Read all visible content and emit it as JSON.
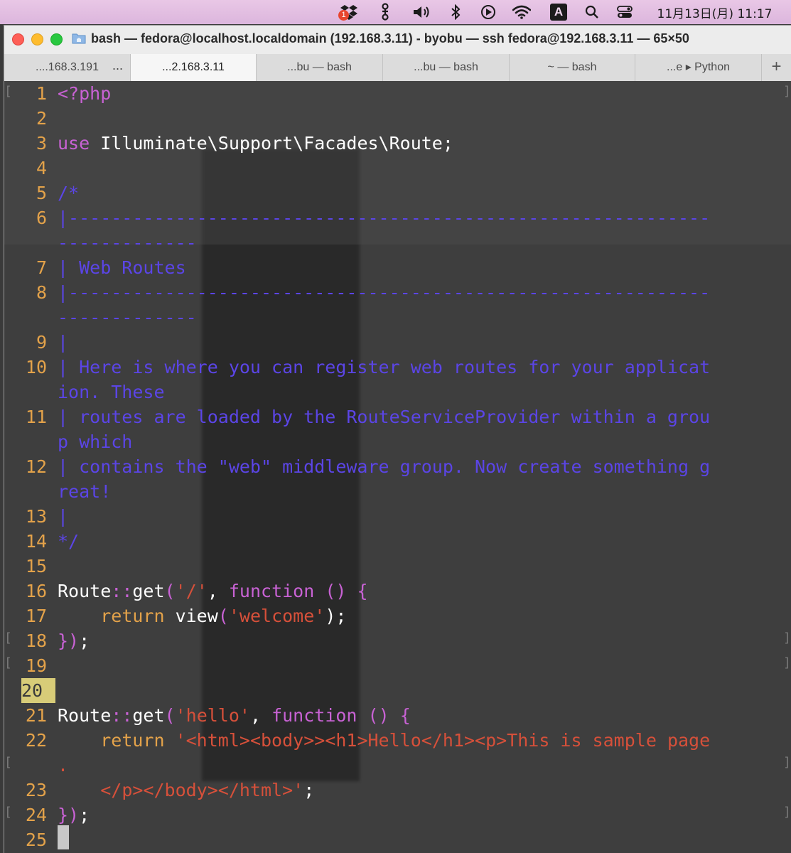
{
  "menubar": {
    "dropbox_badge": "1",
    "time": "11月13日(月)  11:17",
    "input_indicator": "A",
    "icons": [
      "dropbox-icon",
      "git-icon",
      "volume-icon",
      "bluetooth-icon",
      "play-icon",
      "wifi-icon",
      "input-source-icon",
      "spotlight-icon",
      "control-center-icon"
    ]
  },
  "window": {
    "title": "bash — fedora@localhost.localdomain (192.168.3.11) - byobu — ssh fedora@192.168.3.11 — 65×50"
  },
  "tabs": [
    {
      "label": "....168.3.191",
      "active": false
    },
    {
      "label": "...2.168.3.11",
      "active": true
    },
    {
      "label": "...bu — bash",
      "active": false
    },
    {
      "label": "...bu — bash",
      "active": false
    },
    {
      "label": "~ — bash",
      "active": false
    },
    {
      "label": "...e ▸ Python",
      "active": false
    }
  ],
  "tab_overflow": "...",
  "tab_add": "+",
  "editor": {
    "line_numbers": [
      "1",
      "2",
      "3",
      "4",
      "5",
      "6",
      "7",
      "8",
      "9",
      "10",
      "11",
      "12",
      "13",
      "14",
      "15",
      "16",
      "17",
      "18",
      "19",
      "20",
      "21",
      "22",
      "23",
      "24",
      "25"
    ],
    "current_line": "20",
    "l1": "<?php",
    "l3_kw": "use",
    "l3_rest": " Illuminate\\Support\\Facades\\Route;",
    "l5": "/*",
    "l6a": "|------------------------------------------------------------",
    "l6b": "-------------",
    "l7": "| Web Routes",
    "l8a": "|------------------------------------------------------------",
    "l8b": "-------------",
    "l9": "|",
    "l10a": "| Here is where you can register web routes for your applicat",
    "l10b": "ion. These",
    "l11a": "| routes are loaded by the RouteServiceProvider within a grou",
    "l11b": "p which",
    "l12a": "| contains the \"web\" middleware group. Now create something g",
    "l12b": "reat!",
    "l13": "|",
    "l14": "*/",
    "l16_a": "Route",
    "l16_b": "::",
    "l16_c": "get",
    "l16_d": "(",
    "l16_e": "'/'",
    "l16_f": ", ",
    "l16_g": "function",
    "l16_h": " () {",
    "l17_a": "    ",
    "l17_b": "return",
    "l17_c": " view",
    "l17_d": "(",
    "l17_e": "'welcome'",
    "l17_f": ");",
    "l18_a": "})",
    "l18_b": ";",
    "l21_a": "Route",
    "l21_b": "::",
    "l21_c": "get",
    "l21_d": "(",
    "l21_e": "'hello'",
    "l21_f": ", ",
    "l21_g": "function",
    "l21_h": " () {",
    "l22_a": "    ",
    "l22_b": "return",
    "l22_c": " '<html><body>><h1>Hello</h1><p>This is sample page",
    "l22_wrap": ".",
    "l23_a": "    ",
    "l23_b": "</p></body></html>'",
    "l23_c": ";",
    "l24_a": "})",
    "l24_b": ";"
  },
  "colors": {
    "keyword": "#c862d4",
    "comment": "#5b45e6",
    "string": "#d6503a",
    "line_number": "#e3a24a",
    "current_line_bg": "#d8cc78"
  }
}
